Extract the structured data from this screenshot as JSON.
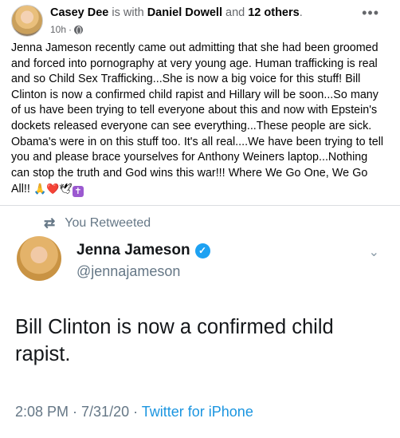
{
  "post": {
    "author": "Casey Dee",
    "with_text": " is with ",
    "tagged": "Daniel Dowell",
    "and_text": " and ",
    "others": "12 others",
    "period": ".",
    "time": "10h",
    "sep": "·",
    "body_text": "Jenna Jameson recently came out admitting that she had been groomed and forced into pornography at very young age. Human trafficking is real and so Child Sex Trafficking...She is now a big voice for this stuff! Bill Clinton is now a confirmed child rapist and Hillary will be soon...So many of us have been trying to tell everyone about this and now with Epstein's dockets released everyone can see everything...These people are sick. Obama's were in on this stuff too. It's all real....We have been trying to tell you and please brace yourselves for Anthony Weiners laptop...Nothing can stop the truth and God wins this war!!! Where We Go One, We Go All!! ",
    "emojis": "🙏❤️🕊",
    "cross": "✝"
  },
  "tweet": {
    "retweet_label": "You Retweeted",
    "name": "Jenna Jameson",
    "handle": "@jennajameson",
    "text": "Bill Clinton is now a confirmed child rapist.",
    "timestamp": "2:08 PM · 7/31/20 · ",
    "source": "Twitter for iPhone"
  }
}
